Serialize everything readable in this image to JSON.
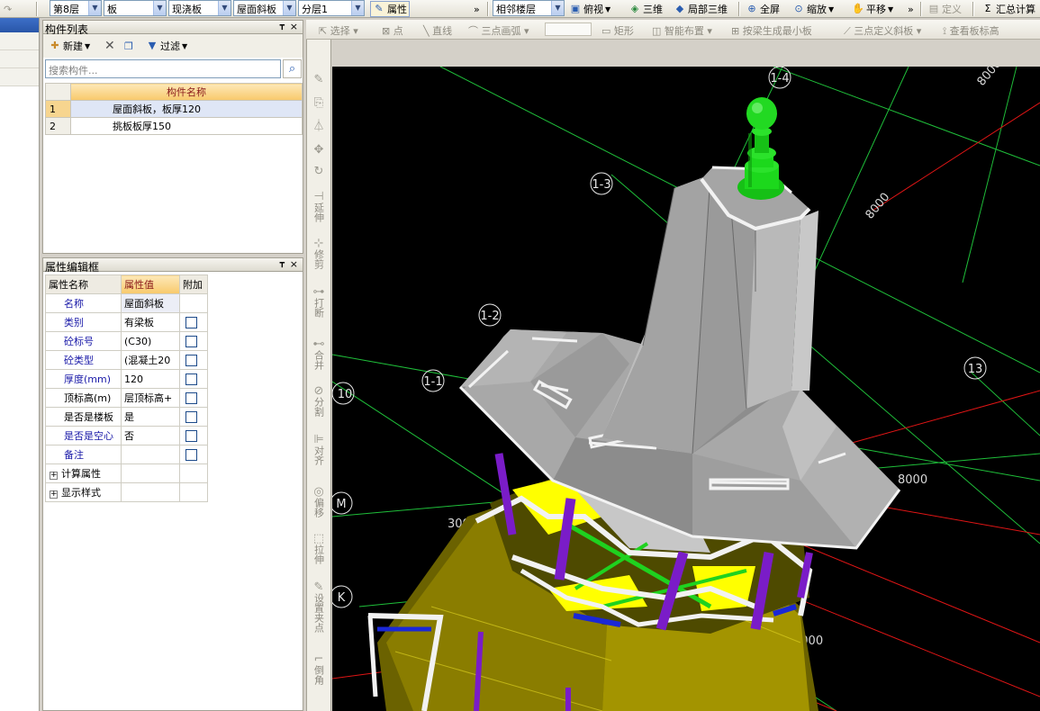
{
  "toolbar": {
    "floor": "第8层",
    "component_type": "板",
    "sub_type": "现浇板",
    "component": "屋面斜板",
    "layer": "分层1",
    "properties_btn": "属性",
    "adjacent_floor": "相邻楼层",
    "view_top": "俯视",
    "view_3d": "三维",
    "local_3d": "局部三维",
    "fullscreen": "全屏",
    "zoom": "缩放",
    "pan": "平移",
    "define": "定义",
    "summary_calc": "汇总计算"
  },
  "draw_toolbar": {
    "select": "选择",
    "point": "点",
    "line": "直线",
    "arc3": "三点画弧",
    "rect": "矩形",
    "smart_layout": "智能布置",
    "gen_slab": "按梁生成最小板",
    "slope3": "三点定义斜板",
    "view_elev": "查看板标高"
  },
  "component_list": {
    "title": "构件列表",
    "new_btn": "新建",
    "filter_btn": "过滤",
    "search_placeholder": "搜索构件...",
    "column_header": "构件名称",
    "rows": [
      {
        "index": "1",
        "name": "屋面斜板，板厚120"
      },
      {
        "index": "2",
        "name": "挑板板厚150"
      }
    ]
  },
  "property_editor": {
    "title": "属性编辑框",
    "headers": {
      "name": "属性名称",
      "value": "属性值",
      "extra": "附加"
    },
    "rows": [
      {
        "name": "名称",
        "value": "屋面斜板"
      },
      {
        "name": "类别",
        "value": "有梁板"
      },
      {
        "name": "砼标号",
        "value": "(C30)"
      },
      {
        "name": "砼类型",
        "value": "(混凝土20"
      },
      {
        "name": "厚度(mm)",
        "value": "120"
      },
      {
        "name": "顶标高(m)",
        "value": "层顶标高+"
      },
      {
        "name": "是否是楼板",
        "value": "是"
      },
      {
        "name": "是否是空心",
        "value": "否"
      },
      {
        "name": "备注",
        "value": ""
      }
    ],
    "groups": [
      "计算属性",
      "显示样式"
    ]
  },
  "vertical_tools": [
    "延伸",
    "修剪",
    "打断",
    "合并",
    "分割",
    "对齐",
    "偏移",
    "拉伸",
    "设置夹点",
    "倒角"
  ],
  "viewport": {
    "axis_labels": [
      "1-4",
      "1-3",
      "1-2",
      "1-1",
      "10",
      "13",
      "M",
      "K"
    ],
    "dimensions": [
      "8000",
      "8000",
      "8000",
      "3000",
      "3000"
    ]
  }
}
